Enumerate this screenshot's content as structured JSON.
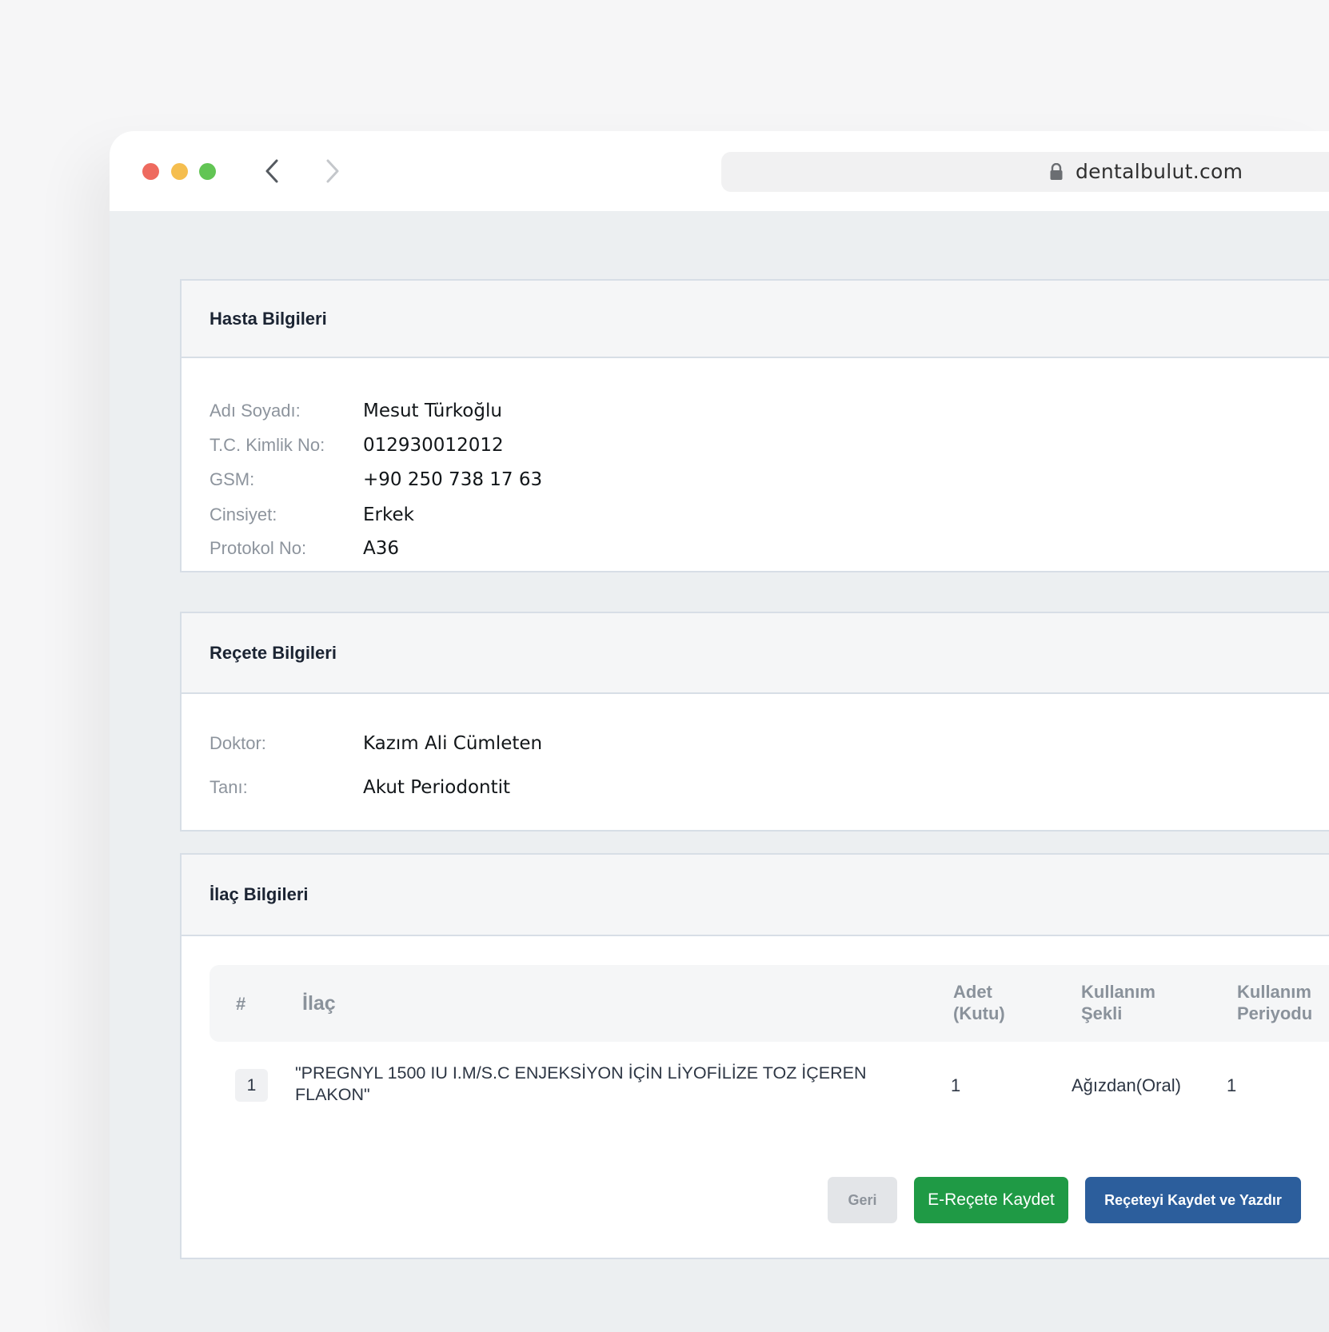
{
  "browser": {
    "url": "dentalbulut.com"
  },
  "patient": {
    "title": "Hasta Bilgileri",
    "fields": [
      {
        "label": "Adı Soyadı:",
        "value": "Mesut Türkoğlu"
      },
      {
        "label": "T.C. Kimlik No:",
        "value": "012930012012"
      },
      {
        "label": "GSM:",
        "value": "+90 250 738 17 63"
      },
      {
        "label": "Cinsiyet:",
        "value": "Erkek"
      },
      {
        "label": "Protokol No:",
        "value": "A36"
      }
    ]
  },
  "prescription": {
    "title": "Reçete Bilgileri",
    "fields": [
      {
        "label": "Doktor:",
        "value": "Kazım Ali Cümleten"
      },
      {
        "label": "Tanı:",
        "value": "Akut Periodontit"
      }
    ]
  },
  "medication": {
    "title": "İlaç Bilgileri",
    "columns": {
      "index": "#",
      "drug": "İlaç",
      "quantity_line1": "Adet",
      "quantity_line2": "(Kutu)",
      "usage_line1": "Kullanım",
      "usage_line2": "Şekli",
      "period_line1": "Kullanım",
      "period_line2": "Periyodu"
    },
    "rows": [
      {
        "index": "1",
        "drug_line1": "\"PREGNYL 1500 IU I.M/S.C ENJEKSİYON İÇİN LİYOFİLİZE TOZ İÇEREN",
        "drug_line2": "FLAKON\"",
        "quantity": "1",
        "usage": "Ağızdan(Oral)",
        "period": "1"
      }
    ]
  },
  "actions": {
    "back_label": "Geri",
    "erecete_label": "E-Reçete Kaydet",
    "save_print_label": "Reçeteyi Kaydet ve Yazdır"
  },
  "colors": {
    "primary_blue": "#2c5e9c",
    "success_green": "#1f9a45",
    "traffic_red": "#ee6a5f",
    "traffic_yellow": "#f5be4f",
    "traffic_green": "#62c554"
  }
}
